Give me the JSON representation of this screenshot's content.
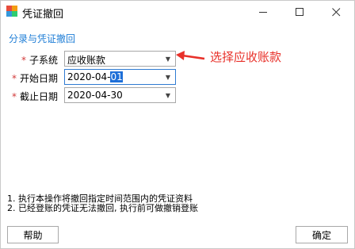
{
  "window": {
    "title": "凭证撤回",
    "icon": "app-logo-icon"
  },
  "section_title": "分录与凭证撤回",
  "form": {
    "required_mark": "*",
    "subsystem": {
      "label": "子系统",
      "value": "应收账款"
    },
    "start_date": {
      "label": "开始日期",
      "value_prefix": "2020-04-",
      "value_selected": "01"
    },
    "end_date": {
      "label": "截止日期",
      "value": "2020-04-30"
    }
  },
  "annotation": {
    "text": "选择应收账款",
    "color": "#e8312a"
  },
  "notes": [
    "1. 执行本操作将撤回指定时间范围内的凭证资料",
    "2. 已经登账的凭证无法撤回, 执行前可做撤销登账"
  ],
  "buttons": {
    "help": "帮助",
    "ok": "确定"
  },
  "colors": {
    "accent": "#1e7dd6",
    "required": "#d23a3a",
    "selection": "#1e6fd8"
  }
}
